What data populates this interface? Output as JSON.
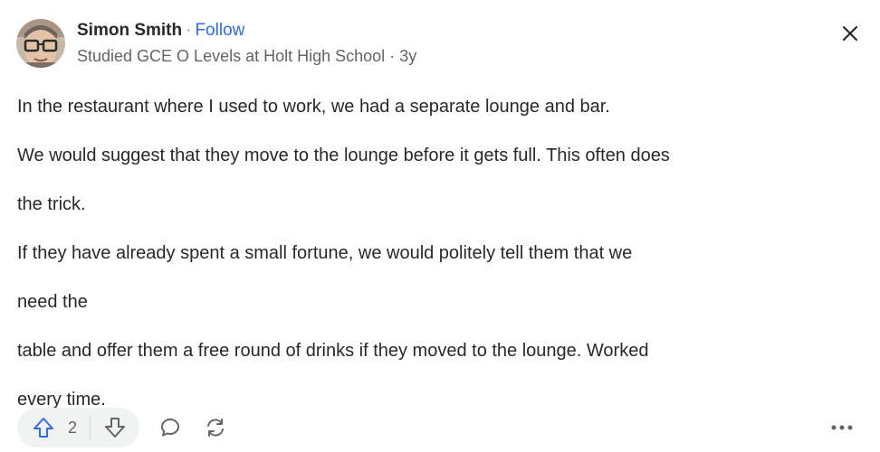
{
  "author": {
    "name": "Simon Smith",
    "separator": "·",
    "follow_label": "Follow",
    "credential": "Studied GCE O Levels at Holt High School",
    "time_separator": "·",
    "age": "3y"
  },
  "answer": {
    "paragraphs": [
      "In the restaurant where I used to work, we had a separate lounge and bar.",
      "We would suggest that they move to the lounge before it gets full. This often does",
      "the trick.",
      "If they have already spent a small fortune, we would politely tell them that we",
      "need the",
      "table and offer them a free round of drinks if they moved to the lounge. Worked",
      "every time."
    ]
  },
  "actions": {
    "upvote_count": "2",
    "icons": {
      "upvote": "upvote-arrow-icon",
      "downvote": "downvote-arrow-icon",
      "comment": "comment-bubble-icon",
      "share": "share-cycle-icon",
      "more": "more-dots-icon",
      "close": "close-icon"
    }
  },
  "colors": {
    "accent": "#2e69ff",
    "text": "#282829",
    "secondary_text": "#636466",
    "pill_background": "#f1f2f2"
  }
}
